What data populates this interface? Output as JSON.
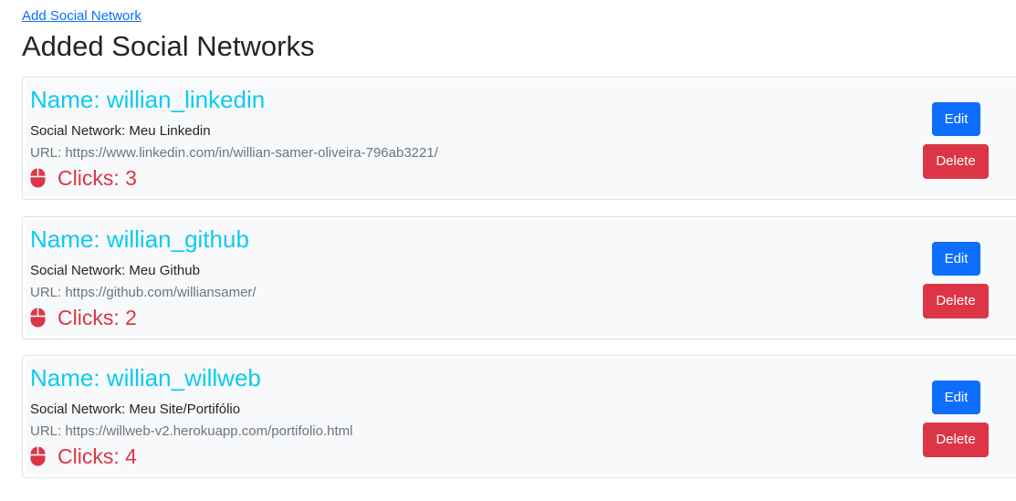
{
  "header": {
    "add_link_label": "Add Social Network",
    "title": "Added Social Networks"
  },
  "colors": {
    "name": "#0dcaf0",
    "clicks": "#dc3545",
    "edit_button": "#0d6efd",
    "delete_button": "#dc3545",
    "url_text": "#6c757d"
  },
  "networks": [
    {
      "name": "Name: willian_linkedin",
      "social_network": "Social Network: Meu Linkedin",
      "url": "URL: https://www.linkedin.com/in/willian-samer-oliveira-796ab3221/",
      "clicks": "Clicks: 3",
      "icon": "mouse-icon",
      "edit_label": "Edit",
      "delete_label": "Delete"
    },
    {
      "name": "Name: willian_github",
      "social_network": "Social Network: Meu Github",
      "url": "URL: https://github.com/williansamer/",
      "clicks": "Clicks: 2",
      "icon": "mouse-icon",
      "edit_label": "Edit",
      "delete_label": "Delete"
    },
    {
      "name": "Name: willian_willweb",
      "social_network": "Social Network: Meu Site/Portifólio",
      "url": "URL: https://willweb-v2.herokuapp.com/portifolio.html",
      "clicks": "Clicks: 4",
      "icon": "mouse-icon",
      "edit_label": "Edit",
      "delete_label": "Delete"
    }
  ]
}
